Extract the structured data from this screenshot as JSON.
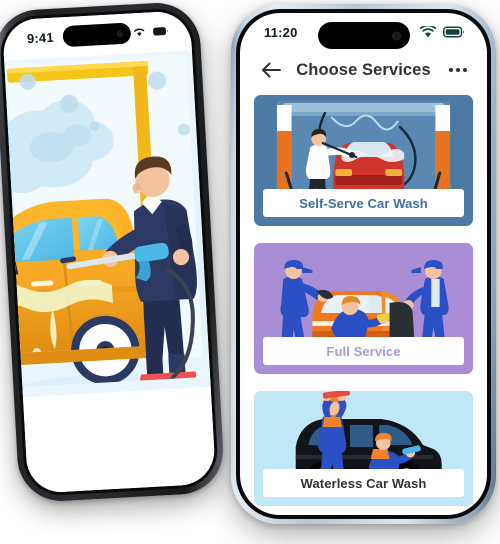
{
  "mockup": {
    "type": "dual-phone-app-mockup",
    "background_color": "#ffffff"
  },
  "left_phone": {
    "frame_color": "#1d1f22",
    "statusbar": {
      "time": "9:41",
      "icons": [
        "cellular-signal-icon",
        "wifi-icon",
        "battery-icon"
      ]
    },
    "screen": {
      "kind": "onboarding-illustration",
      "alt": "Worker in navy overalls pressure-washing a yellow car",
      "background_color": "#e8f4fb",
      "colors": {
        "car_body": "#f5a623",
        "car_body_dark": "#e8901a",
        "car_glass": "#5cc3ef",
        "frame_yellow": "#f5c518",
        "worker_uniform": "#2c3a63",
        "worker_uniform_dark": "#222d4f",
        "worker_skin": "#f3c3a0",
        "worker_hair": "#5a3a22",
        "shoes": "#f0504f",
        "foam": "#cfe9f7",
        "ground": "#ffffff"
      }
    }
  },
  "right_phone": {
    "frame_color": "#c9d8e6",
    "statusbar": {
      "time": "11:20",
      "icons": [
        "wifi-icon",
        "battery-icon"
      ],
      "icon_color": "#13433c"
    },
    "appbar": {
      "back_label": "back-arrow",
      "title": "Choose Services",
      "more_label": "more-options"
    },
    "services": [
      {
        "id": "self-serve-car-wash",
        "label": "Self-Serve Car Wash",
        "card_color": "#4c7aa5",
        "label_bg": "#ffffff",
        "label_color": "#3f6f9e",
        "alt": "Person hosing a red car inside a self-serve wash bay",
        "art": {
          "bay_wall": "#5b88b2",
          "rail": "#9fc0d9",
          "pillar": "#ffffff",
          "pillar_accent": "#e8721e",
          "car": "#d0352b",
          "car_dark": "#9f2119",
          "car_glass": "#d8e6ef",
          "person_shirt": "#ffffff",
          "person_pants": "#20262e",
          "hose": "#1b2a38"
        }
      },
      {
        "id": "full-service",
        "label": "Full Service",
        "card_color": "#a98ed6",
        "label_bg": "#ffffff",
        "label_color": "#a79ad8",
        "alt": "Three workers in blue uniforms detailing an orange car",
        "art": {
          "car": "#f07820",
          "car_dark": "#d25f12",
          "car_glass": "#dfe9f0",
          "uniform": "#2b4fc4",
          "uniform_dark": "#1f3ba0",
          "cap": "#2b4fc4",
          "skin": "#f3c3a0",
          "mat": "#2a2f36",
          "bottles": "#e84a3f"
        }
      },
      {
        "id": "waterless-car-wash",
        "label": "Waterless Car Wash",
        "card_color": "#bfe7f6",
        "label_bg": "#ffffff",
        "label_color": "#2e3338",
        "alt": "Two workers cleaning a black minivan without water",
        "art": {
          "car": "#111418",
          "car_dark": "#05070a",
          "car_glass": "#2e5b87",
          "uniform": "#2b4fc4",
          "uniform_dark": "#1f3ba0",
          "shirt": "#f0832a",
          "skin": "#f3c3a0",
          "ground": "#d8eef8"
        }
      }
    ]
  }
}
